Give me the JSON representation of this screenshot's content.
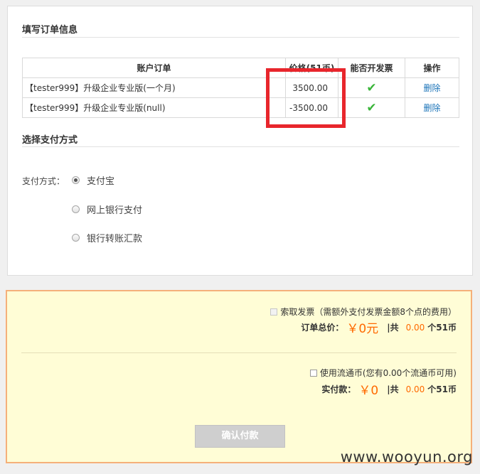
{
  "order_info": {
    "title": "填写订单信息",
    "columns": [
      "账户订单",
      "价格(51币)",
      "能否开发票",
      "操作"
    ],
    "rows": [
      {
        "name": "【tester999】升级企业专业版(一个月)",
        "price": "3500.00",
        "invoice": "✔",
        "action": "删除"
      },
      {
        "name": "【tester999】升级企业专业版(null)",
        "price": "-3500.00",
        "invoice": "✔",
        "action": "删除"
      }
    ]
  },
  "payment": {
    "title": "选择支付方式",
    "label": "支付方式：",
    "options": [
      "支付宝",
      "网上银行支付",
      "银行转账汇款"
    ],
    "selected": "支付宝"
  },
  "summary": {
    "invoice_request": "索取发票（需额外支付发票金额8个点的费用）",
    "total_label": "订单总价：",
    "total_value": "￥0元",
    "total_sep": "|共",
    "total_coins": "0.00",
    "total_coin_unit": "个51币",
    "use_coin_label": "使用流通币(您有0.00个流通币可用)",
    "actual_label": "实付款：",
    "actual_value": "￥0",
    "actual_sep": "|共",
    "actual_coins": "0.00",
    "actual_coin_unit": "个51币",
    "confirm_button": "确认付款"
  },
  "watermark": "www.wooyun.org",
  "colors": {
    "accent_orange": "#ff6a00",
    "highlight_red": "#e8262c",
    "summary_bg": "#fffdd6",
    "check_green": "#3ab53a"
  }
}
